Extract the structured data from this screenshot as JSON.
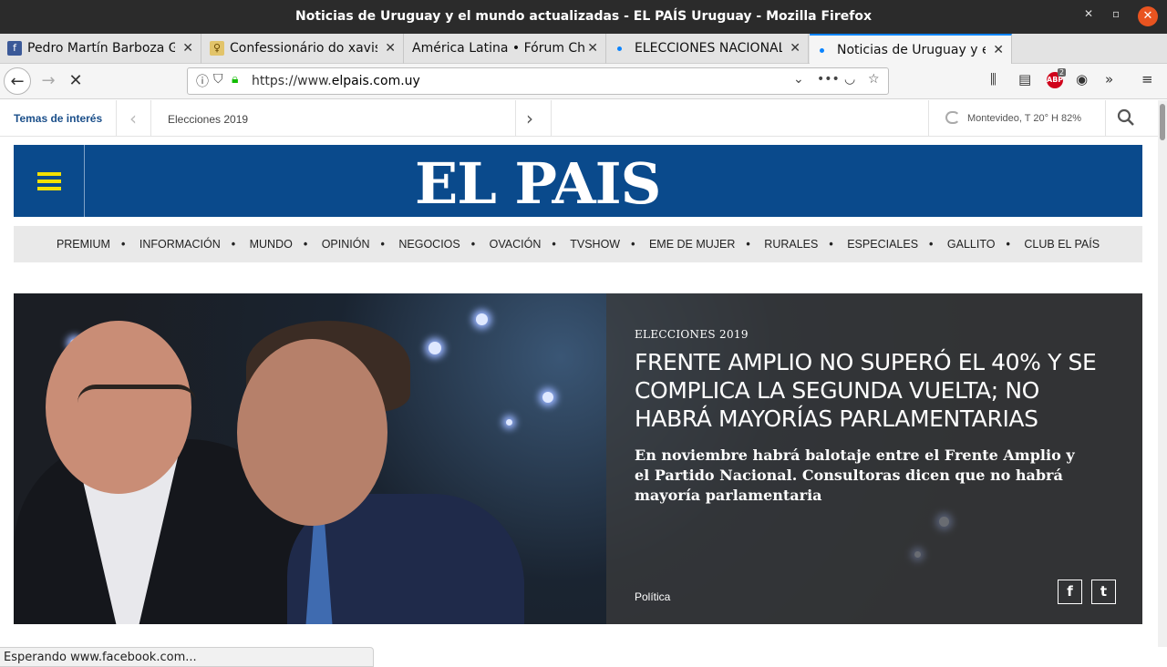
{
  "window": {
    "title": "Noticias de Uruguay y el mundo actualizadas - EL PAÍS Uruguay - Mozilla Firefox"
  },
  "tabs": [
    {
      "label": "Pedro Martín Barboza Go",
      "icon": "facebook-icon",
      "color": "#3b5998"
    },
    {
      "label": "Confessionário do xavis",
      "icon": "site-favicon",
      "color": "#d8a800"
    },
    {
      "label": "América Latina • Fórum Cha",
      "icon": "",
      "color": ""
    },
    {
      "label": "ELECCIONES NACIONALES",
      "icon": "loading-dot",
      "color": "#0a84ff"
    },
    {
      "label": "Noticias de Uruguay y el",
      "icon": "loading-dot",
      "color": "#0a84ff"
    }
  ],
  "navbar": {
    "url_prefix": "https://www.",
    "url_host": "elpais.com.uy",
    "abp_count": "2"
  },
  "site": {
    "temas_label": "Temas de interés",
    "topic": "Elecciones 2019",
    "weather": "Montevideo, T 20° H 82%",
    "logo": "EL PAIS",
    "nav": [
      "PREMIUM",
      "INFORMACIÓN",
      "MUNDO",
      "OPINIÓN",
      "NEGOCIOS",
      "OVACIÓN",
      "TVSHOW",
      "EME DE MUJER",
      "RURALES",
      "ESPECIALES",
      "GALLITO",
      "CLUB EL PAÍS"
    ],
    "nav_separator": "•"
  },
  "hero": {
    "kicker": "ELECCIONES 2019",
    "headline": "FRENTE AMPLIO NO SUPERÓ EL 40% Y SE COMPLICA LA SEGUNDA VUELTA; NO HABRÁ MAYORÍAS PARLAMENTARIAS",
    "summary": "En noviembre habrá balotaje entre el Frente Amplio y el Partido Nacional. Consultoras dicen que no habrá mayoría parlamentaria",
    "section": "Política",
    "facebook": "f",
    "twitter": "t"
  },
  "status": "Esperando www.facebook.com..."
}
